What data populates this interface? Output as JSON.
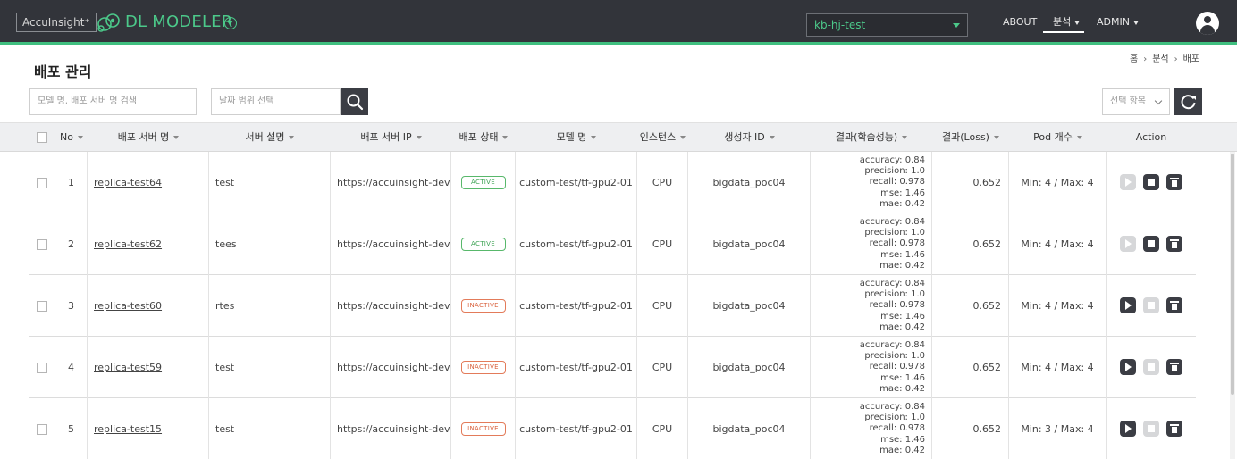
{
  "header": {
    "logo_text": "AccuInsight⁺",
    "brand": "DL MODELER",
    "project": "kb-hj-test",
    "nav": {
      "about": "ABOUT",
      "analysis": "분석",
      "admin": "ADMIN"
    },
    "accent_color": "#3fbf7f"
  },
  "page": {
    "title": "배포 관리",
    "breadcrumb": [
      "홈",
      "분석",
      "배포"
    ]
  },
  "filters": {
    "search_placeholder": "모델 명, 배포 서버 명 검색",
    "date_placeholder": "날짜 범위 선택",
    "column_select": "선택 항목"
  },
  "table": {
    "columns": [
      "No",
      "배포 서버 명",
      "서버 설명",
      "배포 서버 IP",
      "배포 상태",
      "모델 명",
      "인스턴스",
      "생성자 ID",
      "결과(학습성능)",
      "결과(Loss)",
      "Pod 개수",
      "Action"
    ],
    "rows": [
      {
        "no": "1",
        "name": "replica-test64",
        "desc": "test",
        "ip": "https://accuinsight-dev···",
        "status": "ACTIVE",
        "model": "custom-test/tf-gpu2-01",
        "instance": "CPU",
        "creator": "bigdata_poc04",
        "metrics": [
          "accuracy: 0.84",
          "precision: 1.0",
          "recall: 0.978",
          "mse: 1.46",
          "mae: 0.42"
        ],
        "loss": "0.652",
        "pods": "Min: 4 / Max: 4"
      },
      {
        "no": "2",
        "name": "replica-test62",
        "desc": "tees",
        "ip": "https://accuinsight-dev···",
        "status": "ACTIVE",
        "model": "custom-test/tf-gpu2-01",
        "instance": "CPU",
        "creator": "bigdata_poc04",
        "metrics": [
          "accuracy: 0.84",
          "precision: 1.0",
          "recall: 0.978",
          "mse: 1.46",
          "mae: 0.42"
        ],
        "loss": "0.652",
        "pods": "Min: 4 / Max: 4"
      },
      {
        "no": "3",
        "name": "replica-test60",
        "desc": "rtes",
        "ip": "https://accuinsight-dev···",
        "status": "INACTIVE",
        "model": "custom-test/tf-gpu2-01",
        "instance": "CPU",
        "creator": "bigdata_poc04",
        "metrics": [
          "accuracy: 0.84",
          "precision: 1.0",
          "recall: 0.978",
          "mse: 1.46",
          "mae: 0.42"
        ],
        "loss": "0.652",
        "pods": "Min: 4 / Max: 4"
      },
      {
        "no": "4",
        "name": "replica-test59",
        "desc": "test",
        "ip": "https://accuinsight-dev···",
        "status": "INACTIVE",
        "model": "custom-test/tf-gpu2-01",
        "instance": "CPU",
        "creator": "bigdata_poc04",
        "metrics": [
          "accuracy: 0.84",
          "precision: 1.0",
          "recall: 0.978",
          "mse: 1.46",
          "mae: 0.42"
        ],
        "loss": "0.652",
        "pods": "Min: 4 / Max: 4"
      },
      {
        "no": "5",
        "name": "replica-test15",
        "desc": "test",
        "ip": "https://accuinsight-dev···",
        "status": "INACTIVE",
        "model": "custom-test/tf-gpu2-01",
        "instance": "CPU",
        "creator": "bigdata_poc04",
        "metrics": [
          "accuracy: 0.84",
          "precision: 1.0",
          "recall: 0.978",
          "mse: 1.46",
          "mae: 0.42"
        ],
        "loss": "0.652",
        "pods": "Min: 3 / Max: 4"
      }
    ]
  }
}
